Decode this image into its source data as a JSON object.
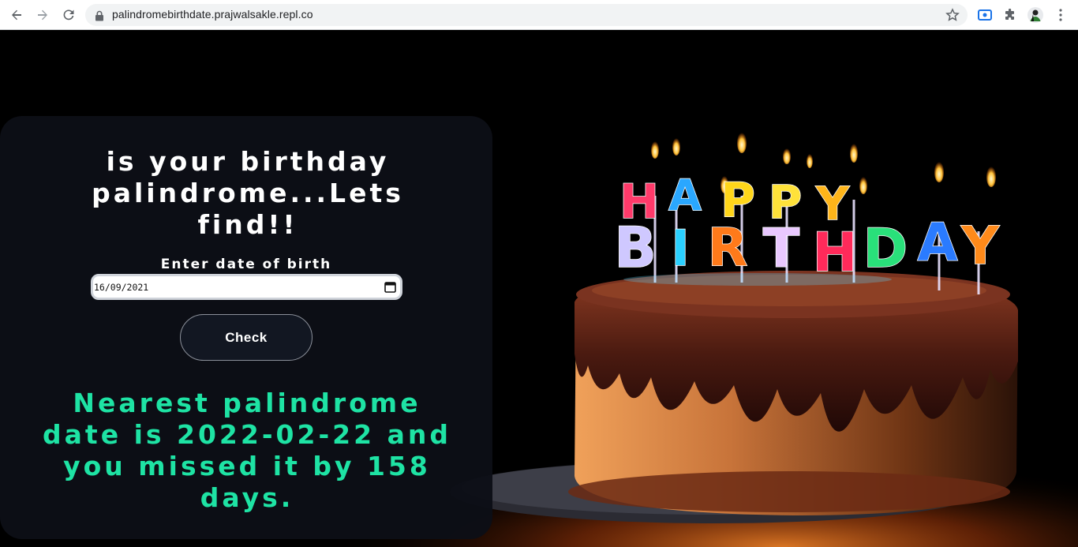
{
  "browser": {
    "url": "palindromebirthdate.prajwalsakle.repl.co",
    "icons": [
      "back-arrow-icon",
      "forward-arrow-icon",
      "reload-icon",
      "lock-icon",
      "star-icon",
      "screen-capture-icon",
      "puzzle-icon",
      "avatar",
      "kebab-menu-icon"
    ]
  },
  "page": {
    "title": "is your birthday palindrome...Lets find!!",
    "dob_label": "Enter date of birth",
    "dob_value": "16/09/2021",
    "check_label": "Check",
    "result": "Nearest palindrome date is 2022-02-22 and you missed it by 158 days.",
    "result_color": "#1ee3a4",
    "background_image": "birthday cake with HAPPY BIRTHDAY candles"
  },
  "candles": {
    "row1": [
      "H",
      "A",
      "P",
      "P",
      "Y"
    ],
    "row2": [
      "B",
      "I",
      "R",
      "T",
      "H",
      "D",
      "A",
      "Y"
    ]
  }
}
